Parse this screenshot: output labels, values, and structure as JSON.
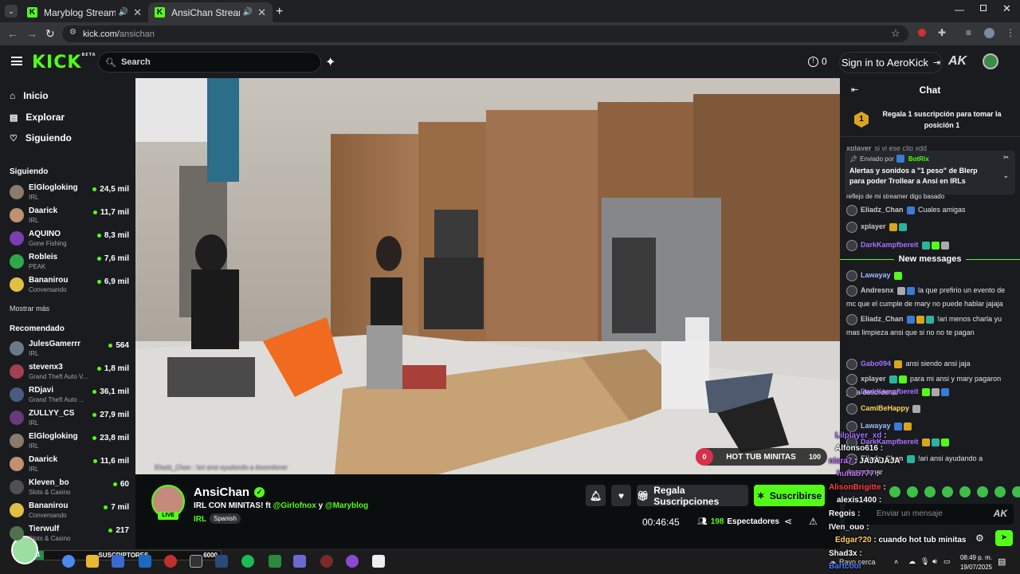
{
  "browser": {
    "tabs": [
      {
        "title": "Maryblog Stream - Watch L"
      },
      {
        "title": "AnsiChan Stream - Watch L"
      }
    ],
    "url_host": "kick.com/",
    "url_path": "ansichan"
  },
  "header": {
    "logo": "KICK",
    "logo_badge": "BETA",
    "search_placeholder": "Search",
    "notif_count": "0",
    "signin_label": "Sign in to AeroKick"
  },
  "sidebar": {
    "nav": [
      {
        "label": "Inicio",
        "icon": "home-icon"
      },
      {
        "label": "Explorar",
        "icon": "compass-icon"
      },
      {
        "label": "Siguiendo",
        "icon": "heart-icon"
      }
    ],
    "following_title": "Siguiendo",
    "following": [
      {
        "name": "ElGlogloking",
        "category": "IRL",
        "viewers": "24,5 mil",
        "color": "#8a7b6b"
      },
      {
        "name": "Daarick",
        "category": "IRL",
        "viewers": "11,7 mil",
        "color": "#c09070"
      },
      {
        "name": "AQUINO",
        "category": "Gone Fishing",
        "viewers": "8,3 mil",
        "color": "#7d3cb0"
      },
      {
        "name": "Robleis",
        "category": "PEAK",
        "viewers": "7,6 mil",
        "color": "#2fa84a"
      },
      {
        "name": "Bananirou",
        "category": "Conversando",
        "viewers": "6,9 mil",
        "color": "#e0c040"
      }
    ],
    "show_more": "Mostrar más",
    "recommended_title": "Recomendado",
    "recommended": [
      {
        "name": "JulesGamerrr",
        "category": "IRL",
        "viewers": "564",
        "color": "#6b7a8a"
      },
      {
        "name": "stevenx3",
        "category": "Grand Theft Auto V...",
        "viewers": "1,8 mil",
        "color": "#a04050"
      },
      {
        "name": "RDjavi",
        "category": "Grand Theft Auto ...",
        "viewers": "36,1 mil",
        "color": "#4a5a80"
      },
      {
        "name": "ZULLYY_CS",
        "category": "IRL",
        "viewers": "27,9 mil",
        "color": "#6a3a7a"
      },
      {
        "name": "ElGlogloking",
        "category": "IRL",
        "viewers": "23,8 mil",
        "color": "#8a7b6b"
      },
      {
        "name": "Daarick",
        "category": "IRL",
        "viewers": "11,6 mil",
        "color": "#c09070"
      },
      {
        "name": "Kleven_bo",
        "category": "Slots & Casino",
        "viewers": "60",
        "color": "#505050"
      },
      {
        "name": "Bananirou",
        "category": "Conversando",
        "viewers": "7 mil",
        "color": "#e0c040"
      },
      {
        "name": "Tierwulf",
        "category": "Slots & Casino",
        "viewers": "217",
        "color": "#507050"
      }
    ]
  },
  "video": {
    "poll_left": "0",
    "poll_label": "HOT TUB MINITAS",
    "poll_right": "100",
    "bottom_chat": "Eliadz_Chan : !ari ansi ayudando a desordenar"
  },
  "stream": {
    "streamer": "AnsiChan",
    "live_badge": "LIVE",
    "title_prefix": "IRL CON MINITAS! ft",
    "mention1": "@Girlofnox",
    "title_and": "y",
    "mention2": "@Maryblog",
    "category": "IRL",
    "tag": "Spanish",
    "gift_label": "Regala Suscripciones",
    "subscribe_label": "Suscribirse",
    "uptime": "00:46:45",
    "viewers": "198",
    "viewers_label": "Espectadores"
  },
  "chat": {
    "title": "Chat",
    "pinned_rank": "1",
    "pinned_text": "Regala 1 suscripción para tomar la posición 1",
    "partial_user": "xplayer",
    "partial_text": "si vi ese clip xdd",
    "pinned_msg_from": "Enviado por",
    "pinned_msg_bot": "BotRix",
    "pinned_msg_text": "Alertas y sonidos a \"1 peso\" de Blerp para poder Trollear a Ansi en IRLs",
    "cut_text": "reflejo de mi streamer digo basado",
    "new_messages": "New messages",
    "messages": [
      {
        "user": "Eliadz_Chan",
        "text": "Cuales amigas",
        "color": "#c9c9c9"
      },
      {
        "user": "xplayer",
        "text": "",
        "color": "#c9c9c9"
      },
      {
        "user": "DarkKampfbereit",
        "text": "",
        "color": "#a770ff"
      },
      {
        "user": "Lawayay",
        "text": "",
        "color": "#9bbaff"
      },
      {
        "user": "Andresnx",
        "text": "la que prefirio un evento de mc que el cumple de mary no puede hablar jajaja",
        "color": "#c9c9c9"
      },
      {
        "user": "Eliadz_Chan",
        "text": "!ari menos charla yu mas limpieza ansi que si no no te pagan",
        "color": "#c9c9c9"
      },
      {
        "user": "Gabo094",
        "text": "ansi siendo ansi jaja",
        "color": "#a770ff"
      },
      {
        "user": "xplayer",
        "text": "para mi ansi y mary pagaron para desordenar",
        "color": "#c9c9c9"
      },
      {
        "user": "DarkKampfbereit",
        "text": "",
        "color": "#a770ff"
      },
      {
        "user": "CamiBeHappy",
        "text": "",
        "color": "#ffd25a"
      },
      {
        "user": "Lawayay",
        "text": "",
        "color": "#9bbaff"
      },
      {
        "user": "DarkKampfbereit",
        "text": "",
        "color": "#a770ff"
      },
      {
        "user": "Eliadz_Chan",
        "text": "!ari ansi ayudando a desordenar",
        "color": "#c9c9c9"
      }
    ],
    "input_placeholder": "Enviar un mensaje"
  },
  "overlay_chat": [
    {
      "user": "Lilplayer_xd",
      "text": ":",
      "color": "#a770ff"
    },
    {
      "user": "Alfonso616",
      "text": ":",
      "color": "#ffffff"
    },
    {
      "user": "niara7",
      "text": ": JAJAJAJA",
      "color": "#c070ff"
    },
    {
      "user": "hunab777",
      "text": ":",
      "color": "#c070ff"
    },
    {
      "user": "AlisonBrigitte",
      "text": ":",
      "color": "#ff4040"
    },
    {
      "user": "alexis1400",
      "text": ":",
      "color": "#ffffff"
    },
    {
      "user": "Regois",
      "text": ":",
      "color": "#ffffff"
    },
    {
      "user": "IVen_ouo",
      "text": ":",
      "color": "#ffffff"
    },
    {
      "user": "Edgar?20",
      "text": ": cuando hot tub minitas",
      "color": "#ffd25a"
    },
    {
      "user": "Shad3x",
      "text": ":",
      "color": "#ffffff"
    },
    {
      "user": "Bartcool",
      "text": "",
      "color": "#4a7aff"
    }
  ],
  "overlay_widget": {
    "label": "SUSCRIPTORES",
    "count": "6000",
    "badge": "67/1"
  },
  "taskbar": {
    "weather": "Rayo cerca",
    "time": "08:49 p. m.",
    "date": "19/07/2025"
  },
  "colors": {
    "accent": "#53fc18",
    "bg": "#0b0e0f",
    "panel": "#191b1f"
  }
}
